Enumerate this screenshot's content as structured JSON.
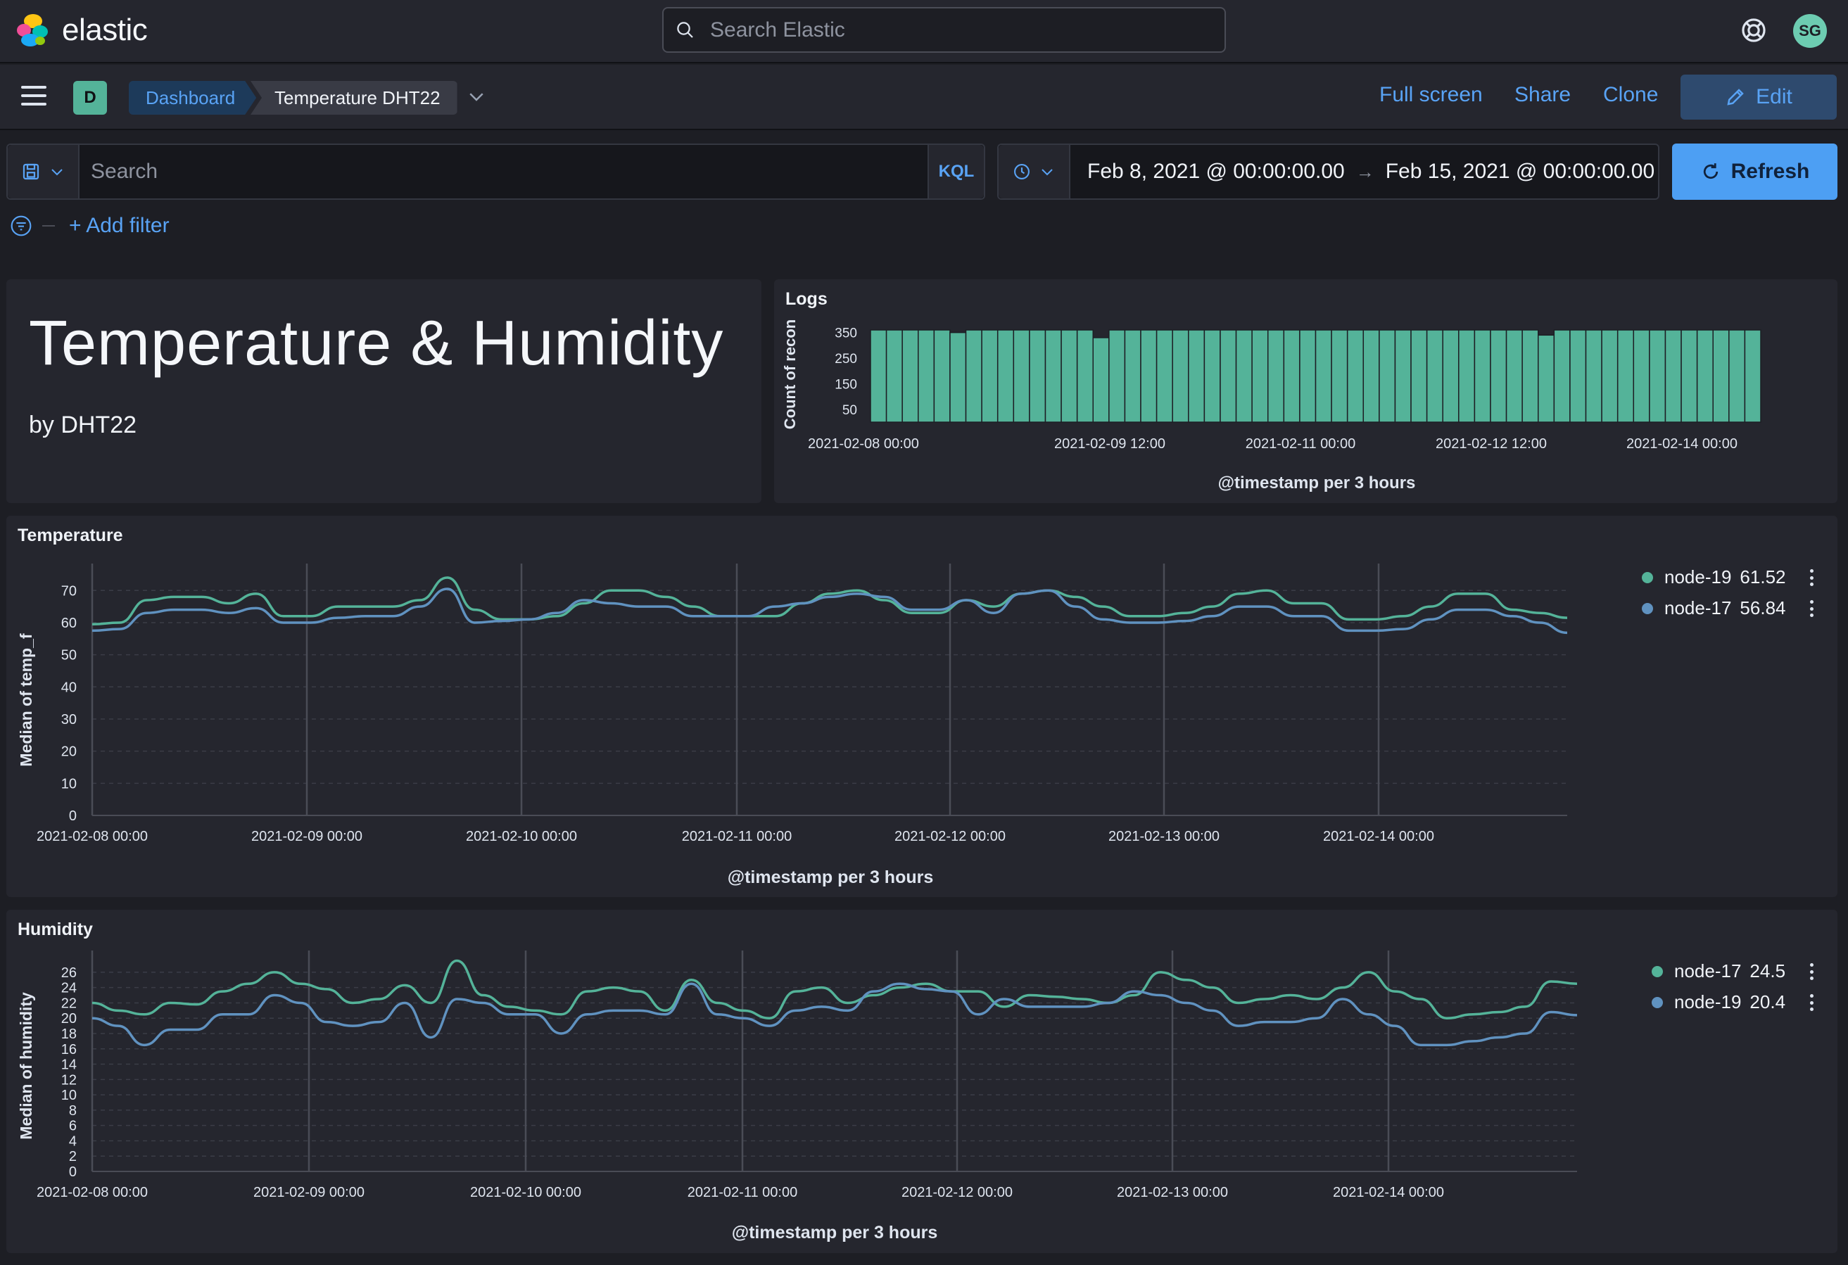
{
  "header": {
    "logo_text": "elastic",
    "search_placeholder": "Search Elastic",
    "avatar_initials": "SG"
  },
  "nav": {
    "space_initial": "D",
    "breadcrumb_root": "Dashboard",
    "breadcrumb_current": "Temperature DHT22",
    "full_screen": "Full screen",
    "share": "Share",
    "clone": "Clone",
    "edit": "Edit"
  },
  "query": {
    "placeholder": "Search",
    "language": "KQL",
    "time_start": "Feb 8, 2021 @ 00:00:00.00",
    "time_end": "Feb 15, 2021 @ 00:00:00.00",
    "refresh": "Refresh",
    "add_filter": "+ Add filter"
  },
  "markdown_panel": {
    "title": "Temperature & Humidity",
    "subtitle": "by DHT22"
  },
  "colors": {
    "green": "#54b399",
    "blue": "#6092c0",
    "accent": "#59a3f5"
  },
  "chart_data": [
    {
      "panel": "Logs",
      "type": "bar",
      "ylabel": "Count of recon",
      "xlabel": "@timestamp per 3 hours",
      "x_ticks": [
        "2021-02-08 00:00",
        "2021-02-09 12:00",
        "2021-02-11 00:00",
        "2021-02-12 12:00",
        "2021-02-14 00:00"
      ],
      "y_ticks": [
        50,
        150,
        250,
        350
      ],
      "ylim": [
        0,
        360
      ],
      "values": [
        360,
        360,
        360,
        360,
        360,
        350,
        360,
        360,
        360,
        360,
        360,
        360,
        360,
        360,
        330,
        360,
        360,
        360,
        360,
        360,
        360,
        360,
        360,
        360,
        360,
        360,
        360,
        360,
        360,
        360,
        360,
        360,
        360,
        360,
        360,
        360,
        360,
        360,
        360,
        360,
        360,
        360,
        340,
        360,
        360,
        360,
        360,
        360,
        360,
        360,
        360,
        360,
        360,
        360,
        360,
        360
      ]
    },
    {
      "panel": "Temperature",
      "type": "line",
      "ylabel": "Median of temp_f",
      "xlabel": "@timestamp per 3 hours",
      "x_ticks": [
        "2021-02-08 00:00",
        "2021-02-09 00:00",
        "2021-02-10 00:00",
        "2021-02-11 00:00",
        "2021-02-12 00:00",
        "2021-02-13 00:00",
        "2021-02-14 00:00"
      ],
      "y_ticks": [
        0,
        10,
        20,
        30,
        40,
        50,
        60,
        70
      ],
      "ylim": [
        0,
        74
      ],
      "series": [
        {
          "name": "node-19",
          "last_value": "61.52",
          "values": [
            59.5,
            60,
            67,
            68,
            68,
            66,
            69,
            62,
            62,
            65,
            65,
            65,
            67,
            74,
            64,
            61,
            61,
            62,
            66,
            70,
            70,
            68,
            65,
            62,
            62,
            62,
            66,
            69,
            70,
            67,
            63,
            63,
            67,
            65,
            69,
            70,
            68,
            65,
            62,
            62,
            63,
            65,
            69,
            70,
            66,
            66,
            61,
            61,
            62,
            65,
            69,
            69,
            64,
            63,
            61.5
          ]
        },
        {
          "name": "node-17",
          "last_value": "56.84",
          "values": [
            57.5,
            58,
            63,
            64,
            64,
            63,
            64.5,
            60,
            60,
            61.5,
            62,
            62,
            65,
            70.5,
            60,
            60.5,
            61,
            63,
            67,
            66,
            65,
            65,
            62,
            62,
            62,
            65,
            66,
            68,
            69,
            68,
            64,
            64,
            67,
            63,
            69,
            70,
            65,
            61,
            60,
            60,
            60.5,
            62,
            65,
            65,
            62,
            62,
            57.5,
            57.5,
            58,
            61,
            64,
            64,
            62,
            60,
            56.84
          ]
        }
      ]
    },
    {
      "panel": "Humidity",
      "type": "line",
      "ylabel": "Median of humidity",
      "xlabel": "@timestamp per 3 hours",
      "x_ticks": [
        "2021-02-08 00:00",
        "2021-02-09 00:00",
        "2021-02-10 00:00",
        "2021-02-11 00:00",
        "2021-02-12 00:00",
        "2021-02-13 00:00",
        "2021-02-14 00:00"
      ],
      "y_ticks": [
        0,
        2,
        4,
        6,
        8,
        10,
        12,
        14,
        16,
        18,
        20,
        22,
        24,
        26
      ],
      "ylim": [
        0,
        27
      ],
      "series": [
        {
          "name": "node-17",
          "last_value": "24.5",
          "values": [
            22,
            21,
            20.5,
            22,
            21.8,
            23.5,
            24.5,
            26,
            24.5,
            23.8,
            22,
            22.5,
            24.3,
            22,
            27.5,
            23,
            21.5,
            21,
            20.5,
            23.5,
            24,
            23.5,
            21,
            25,
            22,
            21,
            20,
            23.5,
            24,
            22,
            23,
            24,
            24.5,
            23.5,
            23.5,
            21.5,
            23,
            22.8,
            22.5,
            22,
            23,
            26,
            25,
            24,
            22,
            22.5,
            23,
            22.5,
            24,
            26,
            23.5,
            22.5,
            20,
            20.5,
            20.8,
            21.5,
            24.8,
            24.5
          ]
        },
        {
          "name": "node-19",
          "last_value": "20.4",
          "values": [
            20,
            19,
            16.5,
            18.5,
            18.5,
            20.5,
            20.5,
            23,
            22,
            19.5,
            19,
            19.5,
            22,
            17.5,
            22.5,
            22,
            20.5,
            20.5,
            18,
            20.5,
            21,
            21,
            20.5,
            24.5,
            20.5,
            20,
            19,
            21,
            21.5,
            21,
            23.5,
            24.5,
            23.8,
            23.5,
            20.5,
            22.5,
            21.5,
            21.5,
            21.5,
            22,
            23.5,
            23,
            22,
            21,
            19,
            19.5,
            19.5,
            20,
            22.5,
            20.5,
            19,
            16.5,
            16.5,
            17,
            17.5,
            18,
            20.8,
            20.4
          ]
        }
      ]
    }
  ]
}
